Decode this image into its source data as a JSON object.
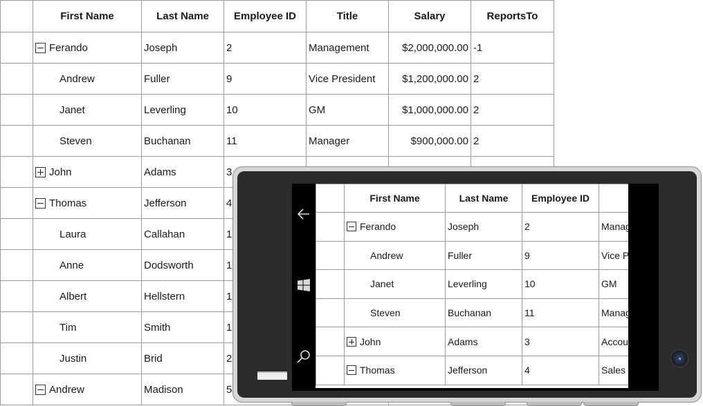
{
  "grid": {
    "headers": [
      "",
      "First Name",
      "Last Name",
      "Employee ID",
      "Title",
      "Salary",
      "ReportsTo"
    ],
    "rows": [
      {
        "toggle": "minus",
        "level": 0,
        "first": "Ferando",
        "last": "Joseph",
        "id": "2",
        "title": "Management",
        "salary": "$2,000,000.00",
        "reports": "-1"
      },
      {
        "toggle": "",
        "level": 1,
        "first": "Andrew",
        "last": "Fuller",
        "id": "9",
        "title": "Vice President",
        "salary": "$1,200,000.00",
        "reports": "2"
      },
      {
        "toggle": "",
        "level": 1,
        "first": "Janet",
        "last": "Leverling",
        "id": "10",
        "title": "GM",
        "salary": "$1,000,000.00",
        "reports": "2"
      },
      {
        "toggle": "",
        "level": 1,
        "first": "Steven",
        "last": "Buchanan",
        "id": "11",
        "title": "Manager",
        "salary": "$900,000.00",
        "reports": "2"
      },
      {
        "toggle": "plus",
        "level": 0,
        "first": "John",
        "last": "Adams",
        "id": "3",
        "title": "",
        "salary": "",
        "reports": ""
      },
      {
        "toggle": "minus",
        "level": 0,
        "first": "Thomas",
        "last": "Jefferson",
        "id": "4",
        "title": "",
        "salary": "",
        "reports": ""
      },
      {
        "toggle": "",
        "level": 1,
        "first": "Laura",
        "last": "Callahan",
        "id": "1",
        "title": "",
        "salary": "",
        "reports": ""
      },
      {
        "toggle": "",
        "level": 1,
        "first": "Anne",
        "last": "Dodsworth",
        "id": "1",
        "title": "",
        "salary": "",
        "reports": ""
      },
      {
        "toggle": "",
        "level": 1,
        "first": "Albert",
        "last": "Hellstern",
        "id": "1",
        "title": "",
        "salary": "",
        "reports": ""
      },
      {
        "toggle": "",
        "level": 1,
        "first": "Tim",
        "last": "Smith",
        "id": "1",
        "title": "",
        "salary": "",
        "reports": ""
      },
      {
        "toggle": "",
        "level": 1,
        "first": "Justin",
        "last": "Brid",
        "id": "2",
        "title": "",
        "salary": "",
        "reports": ""
      },
      {
        "toggle": "minus",
        "level": 0,
        "first": "Andrew",
        "last": "Madison",
        "id": "5",
        "title": "",
        "salary": "",
        "reports": ""
      }
    ]
  },
  "phone": {
    "icons": [
      "back-arrow-icon",
      "windows-icon",
      "search-icon"
    ],
    "headers": [
      "",
      "First Name",
      "Last Name",
      "Employee ID",
      ""
    ],
    "rows": [
      {
        "toggle": "minus",
        "level": 0,
        "first": "Ferando",
        "last": "Joseph",
        "id": "2",
        "title": "Manag"
      },
      {
        "toggle": "",
        "level": 1,
        "first": "Andrew",
        "last": "Fuller",
        "id": "9",
        "title": "Vice P"
      },
      {
        "toggle": "",
        "level": 1,
        "first": "Janet",
        "last": "Leverling",
        "id": "10",
        "title": "GM"
      },
      {
        "toggle": "",
        "level": 1,
        "first": "Steven",
        "last": "Buchanan",
        "id": "11",
        "title": "Manag"
      },
      {
        "toggle": "plus",
        "level": 0,
        "first": "John",
        "last": "Adams",
        "id": "3",
        "title": "Accou"
      },
      {
        "toggle": "minus",
        "level": 0,
        "first": "Thomas",
        "last": "Jefferson",
        "id": "4",
        "title": "Sales"
      }
    ]
  }
}
